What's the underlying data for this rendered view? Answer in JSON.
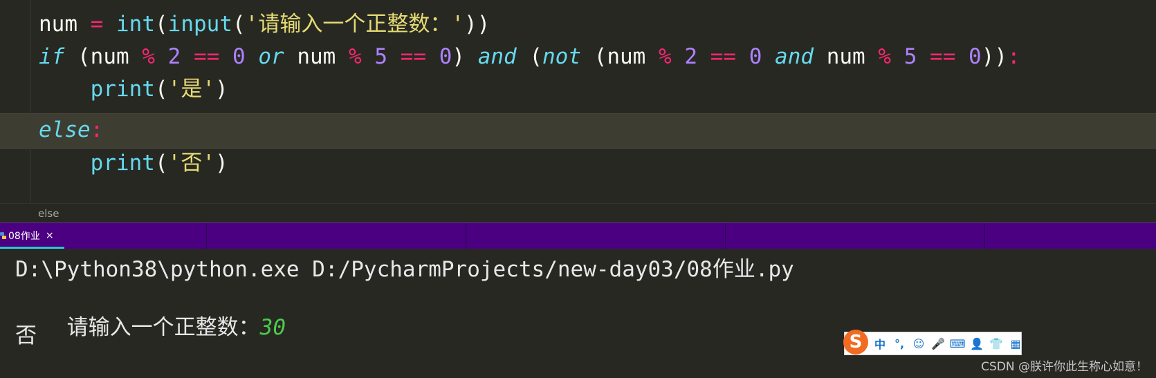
{
  "editor": {
    "lines": [
      {
        "tokens": [
          {
            "t": "num ",
            "c": "plain"
          },
          {
            "t": "=",
            "c": "op"
          },
          {
            "t": " ",
            "c": "plain"
          },
          {
            "t": "int",
            "c": "fn"
          },
          {
            "t": "(",
            "c": "plain"
          },
          {
            "t": "input",
            "c": "fn"
          },
          {
            "t": "(",
            "c": "plain"
          },
          {
            "t": "'请输入一个正整数：'",
            "c": "str"
          },
          {
            "t": "))",
            "c": "plain"
          }
        ]
      },
      {
        "tokens": [
          {
            "t": "if",
            "c": "kw"
          },
          {
            "t": " (num ",
            "c": "plain"
          },
          {
            "t": "%",
            "c": "op"
          },
          {
            "t": " ",
            "c": "plain"
          },
          {
            "t": "2",
            "c": "num"
          },
          {
            "t": " ",
            "c": "plain"
          },
          {
            "t": "==",
            "c": "op"
          },
          {
            "t": " ",
            "c": "plain"
          },
          {
            "t": "0",
            "c": "num"
          },
          {
            "t": " ",
            "c": "plain"
          },
          {
            "t": "or",
            "c": "kw"
          },
          {
            "t": " num ",
            "c": "plain"
          },
          {
            "t": "%",
            "c": "op"
          },
          {
            "t": " ",
            "c": "plain"
          },
          {
            "t": "5",
            "c": "num"
          },
          {
            "t": " ",
            "c": "plain"
          },
          {
            "t": "==",
            "c": "op"
          },
          {
            "t": " ",
            "c": "plain"
          },
          {
            "t": "0",
            "c": "num"
          },
          {
            "t": ") ",
            "c": "plain"
          },
          {
            "t": "and",
            "c": "kw"
          },
          {
            "t": " (",
            "c": "plain"
          },
          {
            "t": "not",
            "c": "kw"
          },
          {
            "t": " (num ",
            "c": "plain"
          },
          {
            "t": "%",
            "c": "op"
          },
          {
            "t": " ",
            "c": "plain"
          },
          {
            "t": "2",
            "c": "num"
          },
          {
            "t": " ",
            "c": "plain"
          },
          {
            "t": "==",
            "c": "op"
          },
          {
            "t": " ",
            "c": "plain"
          },
          {
            "t": "0",
            "c": "num"
          },
          {
            "t": " ",
            "c": "plain"
          },
          {
            "t": "and",
            "c": "kw"
          },
          {
            "t": " num ",
            "c": "plain"
          },
          {
            "t": "%",
            "c": "op"
          },
          {
            "t": " ",
            "c": "plain"
          },
          {
            "t": "5",
            "c": "num"
          },
          {
            "t": " ",
            "c": "plain"
          },
          {
            "t": "==",
            "c": "op"
          },
          {
            "t": " ",
            "c": "plain"
          },
          {
            "t": "0",
            "c": "num"
          },
          {
            "t": "))",
            "c": "plain"
          },
          {
            "t": ":",
            "c": "op"
          }
        ]
      },
      {
        "tokens": [
          {
            "t": "    ",
            "c": "plain"
          },
          {
            "t": "print",
            "c": "fn"
          },
          {
            "t": "(",
            "c": "plain"
          },
          {
            "t": "'是'",
            "c": "str"
          },
          {
            "t": ")",
            "c": "plain"
          }
        ]
      },
      {
        "tokens": [
          {
            "t": "else",
            "c": "kw"
          },
          {
            "t": ":",
            "c": "op"
          }
        ]
      },
      {
        "tokens": [
          {
            "t": "    ",
            "c": "plain"
          },
          {
            "t": "print",
            "c": "fn"
          },
          {
            "t": "(",
            "c": "plain"
          },
          {
            "t": "'否'",
            "c": "str"
          },
          {
            "t": ")",
            "c": "plain"
          }
        ]
      }
    ]
  },
  "breadcrumb": "else",
  "tabs": [
    {
      "label": "08作业",
      "close": "×",
      "active": true,
      "icon": "python-file-icon"
    }
  ],
  "console": {
    "command": "D:\\Python38\\python.exe D:/PycharmProjects/new-day03/08作业.py",
    "prompt": "请输入一个正整数：",
    "input_value": "30",
    "output": "否"
  },
  "ime_toolbar": {
    "logo": "S",
    "items": [
      "中",
      "°,",
      "☺",
      "🎤",
      "⌨",
      "👤",
      "👕",
      "▦"
    ]
  },
  "watermark": "CSDN @朕许你此生称心如意！",
  "colors": {
    "background": "#272822",
    "tabbar": "#4b0082",
    "tab_active_underline": "#2ec4d6",
    "keyword": "#66d9ef",
    "operator": "#f92672",
    "string": "#e6db74",
    "number": "#ae81ff",
    "console_input": "#4ec94e"
  }
}
